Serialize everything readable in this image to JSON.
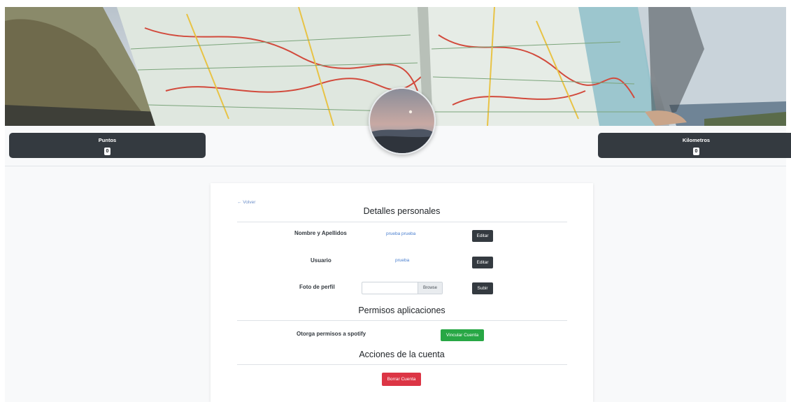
{
  "stats": {
    "points_label": "Puntos",
    "points_value": "0",
    "kilometers_label": "Kilometros",
    "kilometers_value": "0"
  },
  "profile": {
    "back_link": "← Volver",
    "personal_title": "Detalles personales",
    "name_label": "Nombre y Apellidos",
    "name_value": "prueba prueba",
    "name_edit": "Editar",
    "user_label": "Usuario",
    "user_value": "prueba",
    "user_edit": "Editar",
    "photo_label": "Foto de perfil",
    "photo_browse": "Browse",
    "photo_upload": "Subir"
  },
  "permissions": {
    "title": "Permisos aplicaciones",
    "spotify_label": "Otorga permisos a spotify",
    "link_button": "Vincular Cuenta"
  },
  "account": {
    "title": "Acciones de la cuenta",
    "delete_button": "Borrar Cuenta"
  },
  "colors": {
    "dark": "#343a40",
    "success": "#28a745",
    "danger": "#dc3545",
    "link": "#4a7fcf"
  }
}
